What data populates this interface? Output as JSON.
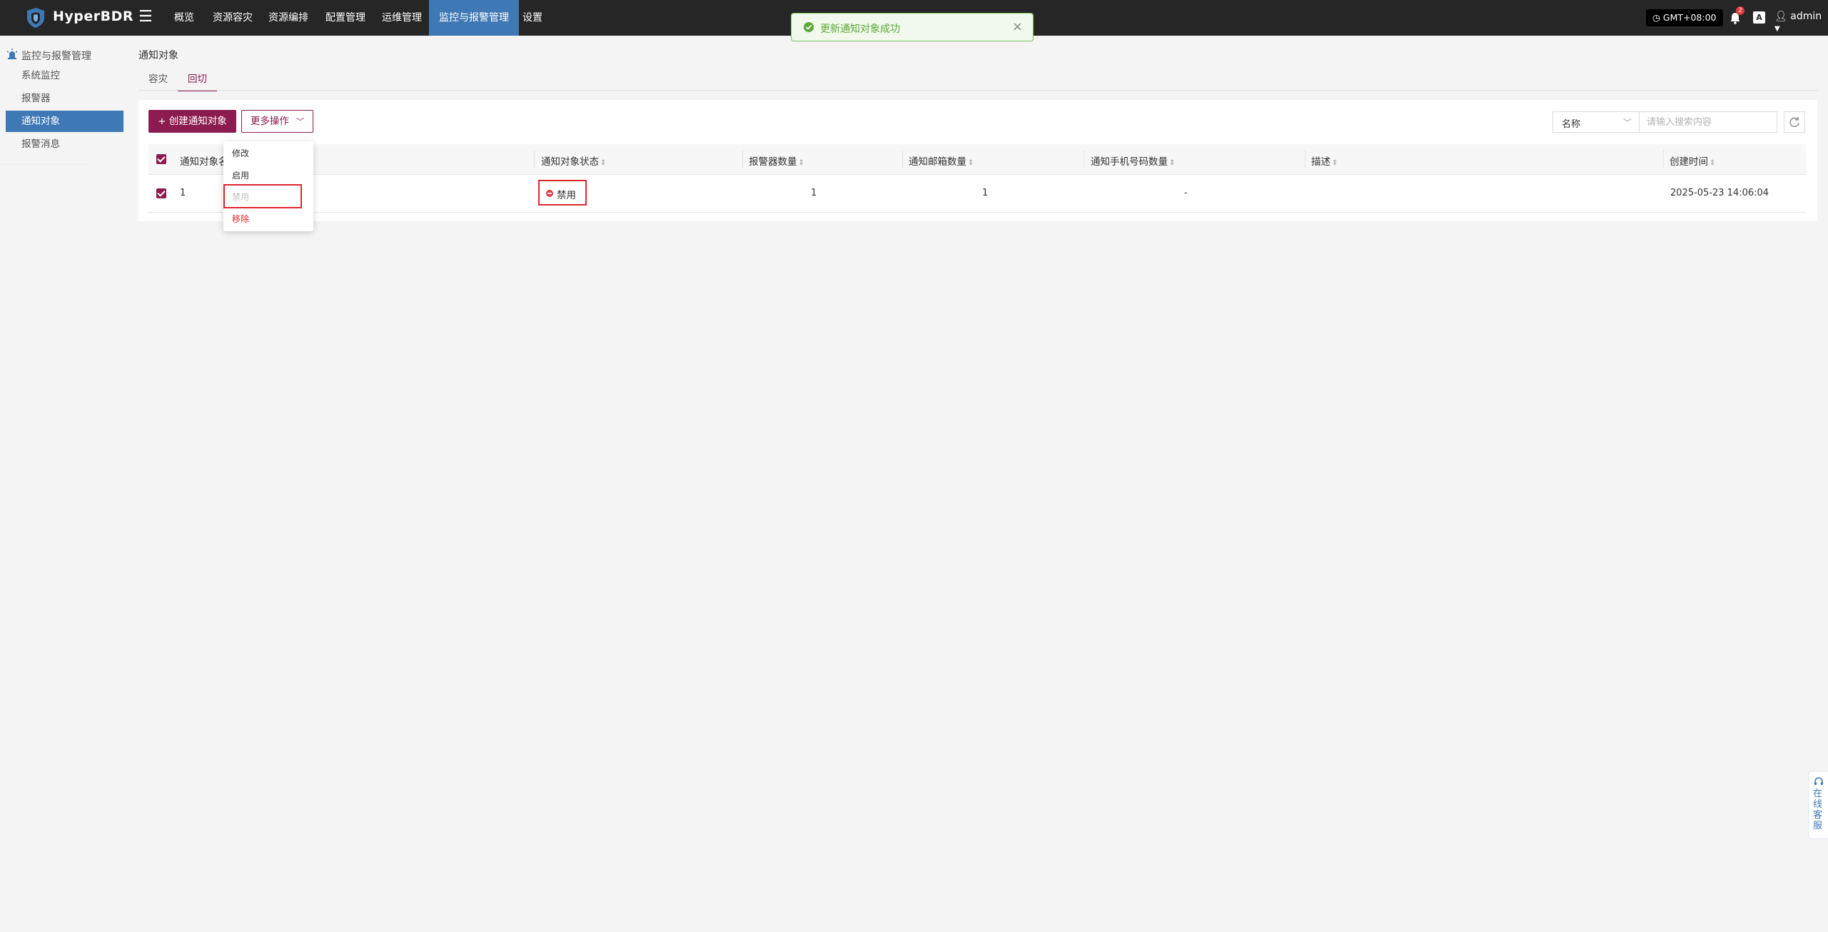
{
  "brand": {
    "name": "HyperBDR"
  },
  "nav": {
    "items": [
      {
        "label": "概览"
      },
      {
        "label": "资源容灾"
      },
      {
        "label": "资源编排"
      },
      {
        "label": "配置管理"
      },
      {
        "label": "运维管理"
      },
      {
        "label": "监控与报警管理",
        "active": true
      },
      {
        "label": "设置"
      }
    ]
  },
  "header": {
    "timezone": "GMT+08:00",
    "notification_count": "2",
    "lang_label": "A",
    "user": "admin"
  },
  "toast": {
    "message": "更新通知对象成功"
  },
  "sidebar": {
    "section_title": "监控与报警管理",
    "items": [
      {
        "label": "系统监控"
      },
      {
        "label": "报警器"
      },
      {
        "label": "通知对象",
        "active": true
      },
      {
        "label": "报警消息"
      }
    ]
  },
  "page": {
    "title": "通知对象",
    "tabs": [
      {
        "label": "容灾"
      },
      {
        "label": "回切",
        "active": true
      }
    ]
  },
  "toolbar": {
    "create_label": "+ 创建通知对象",
    "more_label": "更多操作",
    "filter_select": "名称",
    "search_placeholder": "请输入搜索内容"
  },
  "dropdown": {
    "items": [
      {
        "label": "修改"
      },
      {
        "label": "启用"
      },
      {
        "label": "禁用",
        "disabled": true
      },
      {
        "label": "移除",
        "danger": true
      }
    ]
  },
  "table": {
    "columns": [
      "通知对象名称",
      "通知对象状态",
      "报警器数量",
      "通知邮箱数量",
      "通知手机号码数量",
      "描述",
      "创建时间"
    ],
    "rows": [
      {
        "name": "1",
        "status": "禁用",
        "alarm_count": "1",
        "email_count": "1",
        "phone_count": "-",
        "description": "",
        "created_at": "2025-05-23 14:06:04"
      }
    ]
  },
  "support": {
    "label": "在线客服"
  },
  "colors": {
    "topbar": "#262626",
    "accent": "#8c1c4f",
    "nav_active": "#3e78b5",
    "danger": "#e0262e",
    "success": "#5da83a"
  }
}
